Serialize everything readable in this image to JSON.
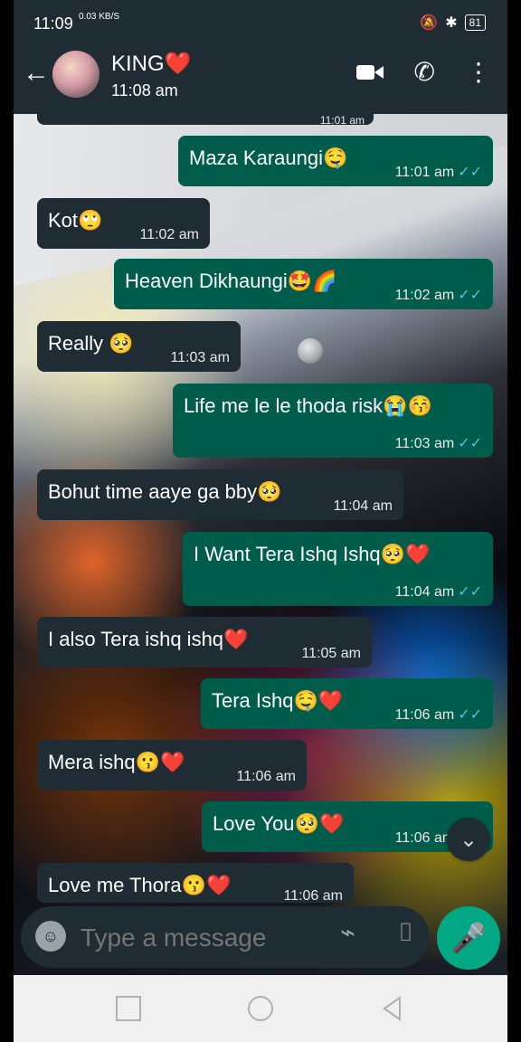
{
  "status": {
    "time": "11:09",
    "network": "0.03 KB/S",
    "battery": "81"
  },
  "chat": {
    "name": "KING❤️",
    "last_seen": "11:08 am"
  },
  "messages": [
    {
      "side": "out",
      "text": "Maza Karaungi🤤",
      "time": "11:01 am",
      "checks": "✓✓"
    },
    {
      "side": "in",
      "text": "Kot🙄",
      "time": "11:02 am"
    },
    {
      "side": "out",
      "text": "Heaven Dikhaungi🤩🌈",
      "time": "11:02 am",
      "checks": "✓✓"
    },
    {
      "side": "in",
      "text": "Really 🥺",
      "time": "11:03 am"
    },
    {
      "side": "out",
      "text": "Life me le le thoda risk😭😚",
      "time": "11:03 am",
      "checks": "✓✓"
    },
    {
      "side": "in",
      "text": "Bohut time aaye ga bby🥺",
      "time": "11:04 am"
    },
    {
      "side": "out",
      "text": "I Want Tera  Ishq Ishq🥺❤️",
      "time": "11:04 am",
      "checks": "✓✓"
    },
    {
      "side": "in",
      "text": "I also Tera ishq ishq❤️",
      "time": "11:05 am"
    },
    {
      "side": "out",
      "text": "Tera Ishq🤤❤️",
      "time": "11:06 am",
      "checks": "✓✓"
    },
    {
      "side": "in",
      "text": "Mera ishq😗❤️",
      "time": "11:06 am"
    },
    {
      "side": "out",
      "text": "Love You🥺❤️",
      "time": "11:06 am",
      "checks": "✓✓"
    },
    {
      "side": "in",
      "text": "Love me Thora😗❤️",
      "time": "11:06 am"
    }
  ],
  "composer": {
    "placeholder": "Type a message"
  },
  "icons": {
    "back": "arrow-left-icon",
    "video": "video-camera-icon",
    "call": "phone-icon",
    "menu": "more-vertical-icon",
    "emoji": "emoji-icon",
    "attach": "paperclip-icon",
    "camera": "camera-icon",
    "mic": "microphone-icon",
    "scroll": "chevron-double-down-icon"
  }
}
